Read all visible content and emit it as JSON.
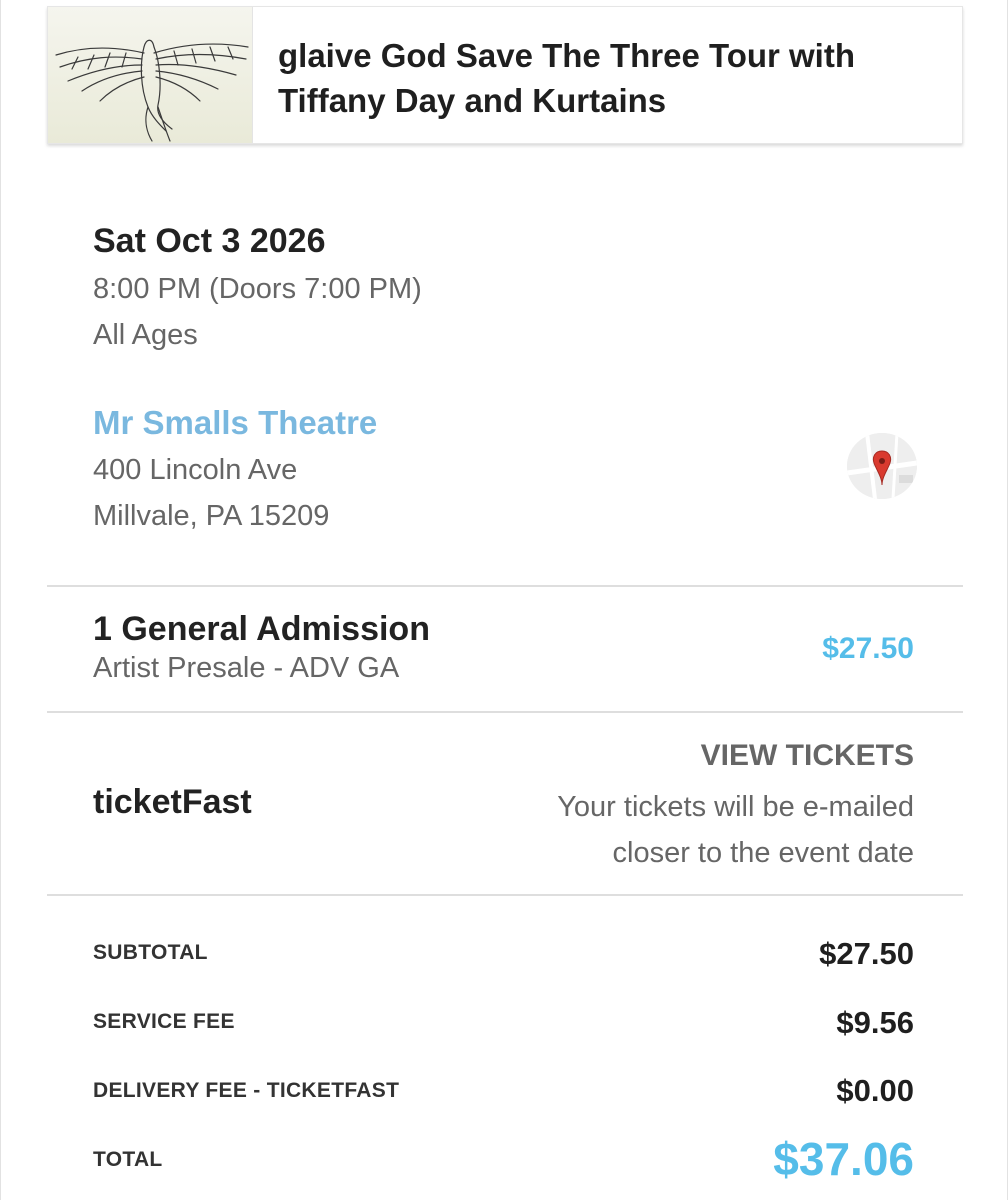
{
  "event": {
    "title": "glaive God Save The Three Tour with Tiffany Day and Kurtains",
    "image_icon": "bird-illustration-icon"
  },
  "schedule": {
    "date": "Sat Oct 3 2026",
    "time": "8:00 PM (Doors 7:00 PM)",
    "ages": "All Ages"
  },
  "venue": {
    "name": "Mr Smalls Theatre",
    "address_line1": "400 Lincoln Ave",
    "address_line2": "Millvale, PA 15209",
    "map_icon": "map-pin-icon"
  },
  "ticket": {
    "quantity_label": "1 General Admission",
    "type": "Artist Presale - ADV GA",
    "price": "$27.50"
  },
  "delivery": {
    "method": "ticketFast",
    "view_label": "VIEW TICKETS",
    "note": "Your tickets will be e-mailed closer to the event date"
  },
  "summary": {
    "subtotal_label": "SUBTOTAL",
    "subtotal_value": "$27.50",
    "service_fee_label": "SERVICE FEE",
    "service_fee_value": "$9.56",
    "delivery_fee_label": "DELIVERY FEE - TICKETFAST",
    "delivery_fee_value": "$0.00",
    "total_label": "TOTAL",
    "total_value": "$37.06"
  },
  "colors": {
    "accent": "#55bde9",
    "link": "#7ab8df",
    "text_primary": "#222222",
    "text_secondary": "#666666"
  }
}
